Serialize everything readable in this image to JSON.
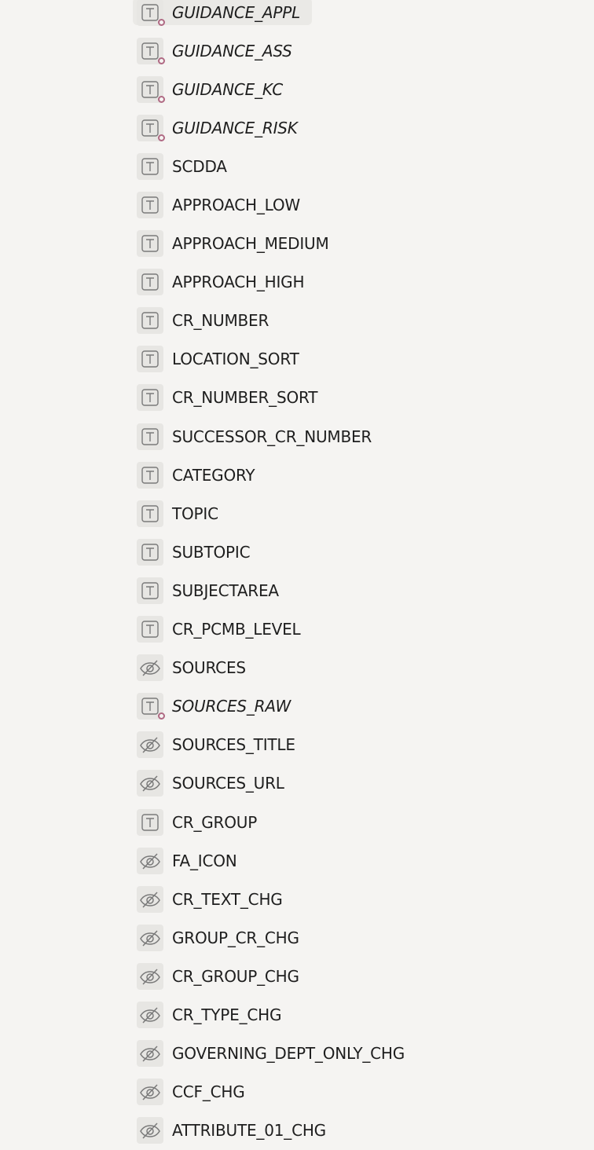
{
  "fields": [
    {
      "label": "GUIDANCE_APPL",
      "icon": "text-field-icon",
      "calculated": true,
      "selected": true
    },
    {
      "label": "GUIDANCE_ASS",
      "icon": "text-field-icon",
      "calculated": true
    },
    {
      "label": "GUIDANCE_KC",
      "icon": "text-field-icon",
      "calculated": true
    },
    {
      "label": "GUIDANCE_RISK",
      "icon": "text-field-icon",
      "calculated": true
    },
    {
      "label": "SCDDA",
      "icon": "text-field-icon"
    },
    {
      "label": "APPROACH_LOW",
      "icon": "text-field-icon"
    },
    {
      "label": "APPROACH_MEDIUM",
      "icon": "text-field-icon"
    },
    {
      "label": "APPROACH_HIGH",
      "icon": "text-field-icon"
    },
    {
      "label": "CR_NUMBER",
      "icon": "text-field-icon"
    },
    {
      "label": "LOCATION_SORT",
      "icon": "text-field-icon"
    },
    {
      "label": "CR_NUMBER_SORT",
      "icon": "text-field-icon"
    },
    {
      "label": "SUCCESSOR_CR_NUMBER",
      "icon": "text-field-icon"
    },
    {
      "label": "CATEGORY",
      "icon": "text-field-icon"
    },
    {
      "label": "TOPIC",
      "icon": "text-field-icon"
    },
    {
      "label": "SUBTOPIC",
      "icon": "text-field-icon"
    },
    {
      "label": "SUBJECTAREA",
      "icon": "text-field-icon"
    },
    {
      "label": "CR_PCMB_LEVEL",
      "icon": "text-field-icon"
    },
    {
      "label": "SOURCES",
      "icon": "hidden-eye-icon"
    },
    {
      "label": "SOURCES_RAW",
      "icon": "text-field-icon",
      "calculated": true
    },
    {
      "label": "SOURCES_TITLE",
      "icon": "hidden-eye-icon"
    },
    {
      "label": "SOURCES_URL",
      "icon": "hidden-eye-icon"
    },
    {
      "label": "CR_GROUP",
      "icon": "text-field-icon"
    },
    {
      "label": "FA_ICON",
      "icon": "hidden-eye-icon"
    },
    {
      "label": "CR_TEXT_CHG",
      "icon": "hidden-eye-icon"
    },
    {
      "label": "GROUP_CR_CHG",
      "icon": "hidden-eye-icon"
    },
    {
      "label": "CR_GROUP_CHG",
      "icon": "hidden-eye-icon"
    },
    {
      "label": "CR_TYPE_CHG",
      "icon": "hidden-eye-icon"
    },
    {
      "label": "GOVERNING_DEPT_ONLY_CHG",
      "icon": "hidden-eye-icon"
    },
    {
      "label": "CCF_CHG",
      "icon": "hidden-eye-icon"
    },
    {
      "label": "ATTRIBUTE_01_CHG",
      "icon": "hidden-eye-icon"
    }
  ],
  "colors": {
    "background": "#f5f4f2",
    "icon_bg": "#e7e6e3",
    "calc_marker": "#b06a84",
    "text": "#1e1e1e"
  }
}
